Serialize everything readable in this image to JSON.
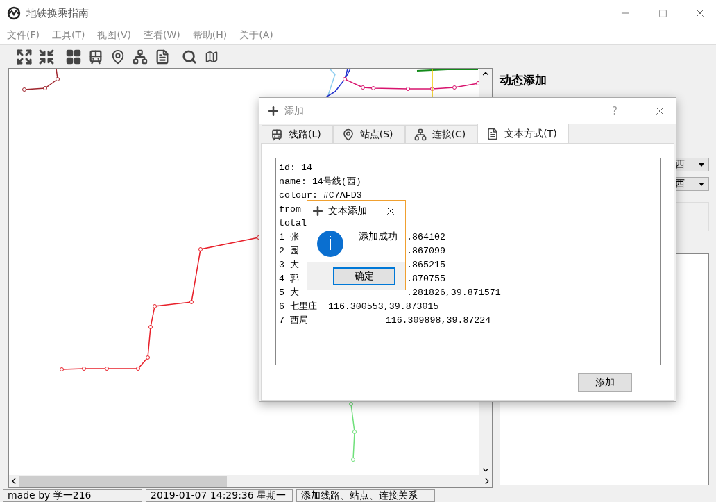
{
  "window": {
    "title": "地铁换乘指南"
  },
  "menu": [
    "文件(F)",
    "工具(T)",
    "视图(V)",
    "查看(W)",
    "帮助(H)",
    "关于(A)"
  ],
  "right_panel": {
    "title": "动态添加",
    "combos": [
      {
        "value": "西"
      },
      {
        "value": "西"
      }
    ]
  },
  "dialog": {
    "title": "添加",
    "help": "?",
    "tabs": [
      {
        "label": "线路(L)",
        "selected": false
      },
      {
        "label": "站点(S)",
        "selected": false
      },
      {
        "label": "连接(C)",
        "selected": false
      },
      {
        "label": "文本方式(T)",
        "selected": true
      }
    ],
    "text_lines": [
      {
        "head": "id: 14"
      },
      {
        "head": "name: 14号线(西)"
      },
      {
        "head": "colour: #C7AFD3"
      },
      {
        "head": "from"
      },
      {
        "head": "total"
      },
      {
        "head": "1 张",
        "tail": ".864102"
      },
      {
        "head": "2 园",
        "tail": ".867099"
      },
      {
        "head": "3 大",
        "tail": ".865215"
      },
      {
        "head": "4 郭",
        "tail": ".870755"
      },
      {
        "head": "5 大",
        "tail": ".281826,39.871571"
      },
      {
        "head": "6 七里庄  116.300553,39.873015"
      },
      {
        "head": "7 西局              116.309898,39.87224"
      }
    ],
    "button": "添加"
  },
  "message": {
    "title": "文本添加",
    "text": "添加成功",
    "button": "确定"
  },
  "status_bar": [
    "made by 学一216",
    "2019-01-07 14:29:36 星期一",
    "添加线路、站点、连接关系"
  ]
}
